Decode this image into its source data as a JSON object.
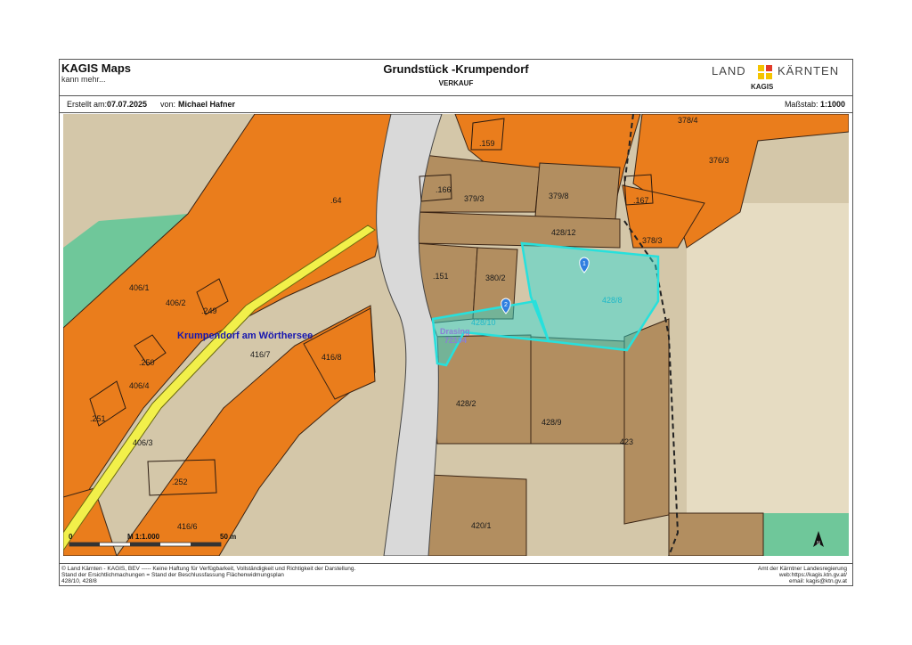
{
  "header": {
    "app_title": "KAGIS Maps",
    "app_subtitle": "kann mehr...",
    "doc_title": "Grundstück -Krumpendorf",
    "doc_subtitle": "VERKAUF",
    "logo_left": "LAND",
    "logo_right": "KÄRNTEN",
    "logo_sub": "KAGIS"
  },
  "info": {
    "created_label": "Erstellt am:",
    "created_value": "07.07.2025",
    "by_label": "von:",
    "by_value": "Michael Hafner",
    "scale_label": "Maßstab:",
    "scale_value": "1:1000"
  },
  "map": {
    "place_label": "Krumpendorf am Wörthersee",
    "locality_label_1": "Drasing",
    "locality_label_2": "72104",
    "markers": [
      "1",
      "2"
    ],
    "parcels": {
      "p378_4": "378/4",
      "p376_3": "376/3",
      "p159": ".159",
      "p166": ".166",
      "p379_3": "379/3",
      "p379_8": "379/8",
      "p167": ".167",
      "p64": ".64",
      "p428_12": "428/12",
      "p378_3": "378/3",
      "p151": ".151",
      "p380_2": "380/2",
      "p428_8": "428/8",
      "p428_10": "428/10",
      "p406_1": "406/1",
      "p406_2": "406/2",
      "p249": ".249",
      "p250": ".250",
      "p406_4": "406/4",
      "p416_7": "416/7",
      "p416_8": "416/8",
      "p251": ".251",
      "p428_2": "428/2",
      "p428_9": "428/9",
      "p423": "423",
      "p406_3": "406/3",
      "p252": ".252",
      "p416_6": "416/6",
      "p420_1": "420/1"
    },
    "scalebar": {
      "zero": "0",
      "label": "M 1:1.000",
      "end": "50 m"
    },
    "north_icon": "north-arrow-icon",
    "colors": {
      "building_zone": "#ea7d1c",
      "green_zone": "#6fc79a",
      "selection": "#27e0dc",
      "road": "#f2f04a",
      "background": "#d6c9ac"
    }
  },
  "footer": {
    "left_1": "© Land Kärnten - KAGIS, BEV ----- Keine Haftung für Verfügbarkeit, Vollständigkeit und Richtigkeit der Darstellung.",
    "left_2": "Stand der Ersichtlichmachungen = Stand der Beschlussfassung Flächenwidmungsplan",
    "left_3": "428/10, 428/8",
    "right_1": "Amt der Kärntner Landesregierung",
    "right_2": "web:https://kagis.ktn.gv.at/",
    "right_3": "email: kagis@ktn.gv.at"
  }
}
